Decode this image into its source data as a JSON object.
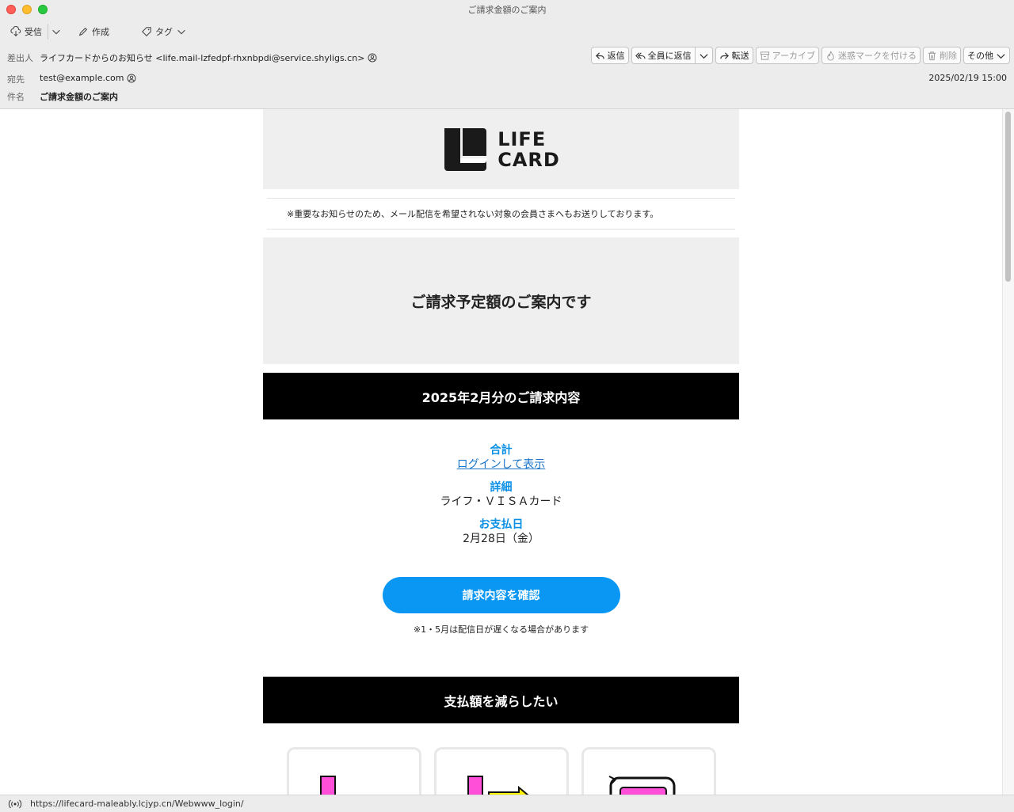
{
  "window": {
    "title": "ご請求金額のご案内"
  },
  "toolbar": {
    "receive": "受信",
    "compose": "作成",
    "tag": "タグ"
  },
  "header": {
    "from_label": "差出人",
    "from_value": "ライフカードからのお知らせ <life.mail-lzfedpf-rhxnbpdi@service.shyligs.cn>",
    "to_label": "宛先",
    "to_value": "test@example.com",
    "subject_label": "件名",
    "subject_value": "ご請求金額のご案内",
    "date": "2025/02/19 15:00",
    "actions": {
      "reply": "返信",
      "reply_all": "全員に返信",
      "forward": "転送",
      "archive": "アーカイブ",
      "junk": "迷惑マークを付ける",
      "delete": "削除",
      "more": "その他"
    }
  },
  "mail": {
    "logo_line1": "LIFE",
    "logo_line2": "CARD",
    "notice": "※重要なお知らせのため、メール配信を希望されない対象の会員さまへもお送りしております。",
    "hero_title": "ご請求予定額のご案内です",
    "billing_heading": "2025年2月分のご請求内容",
    "total_label": "合計",
    "total_link": "ログインして表示",
    "detail_label": "詳細",
    "detail_value": "ライフ・ＶＩＳＡカード",
    "payday_label": "お支払日",
    "payday_value": "2月28日（金）",
    "cta_button": "請求内容を確認",
    "cta_note": "※1・5月は配信日が遅くなる場合があります",
    "reduce_heading": "支払額を減らしたい"
  },
  "status": {
    "url": "https://lifecard-maleably.lcjyp.cn/Webwww_login/"
  },
  "colors": {
    "accent_blue": "#0a97f3",
    "label_blue": "#0a8fe6",
    "link_blue": "#1b74c9",
    "magenta": "#ff4fd8",
    "yellow": "#fff200"
  }
}
